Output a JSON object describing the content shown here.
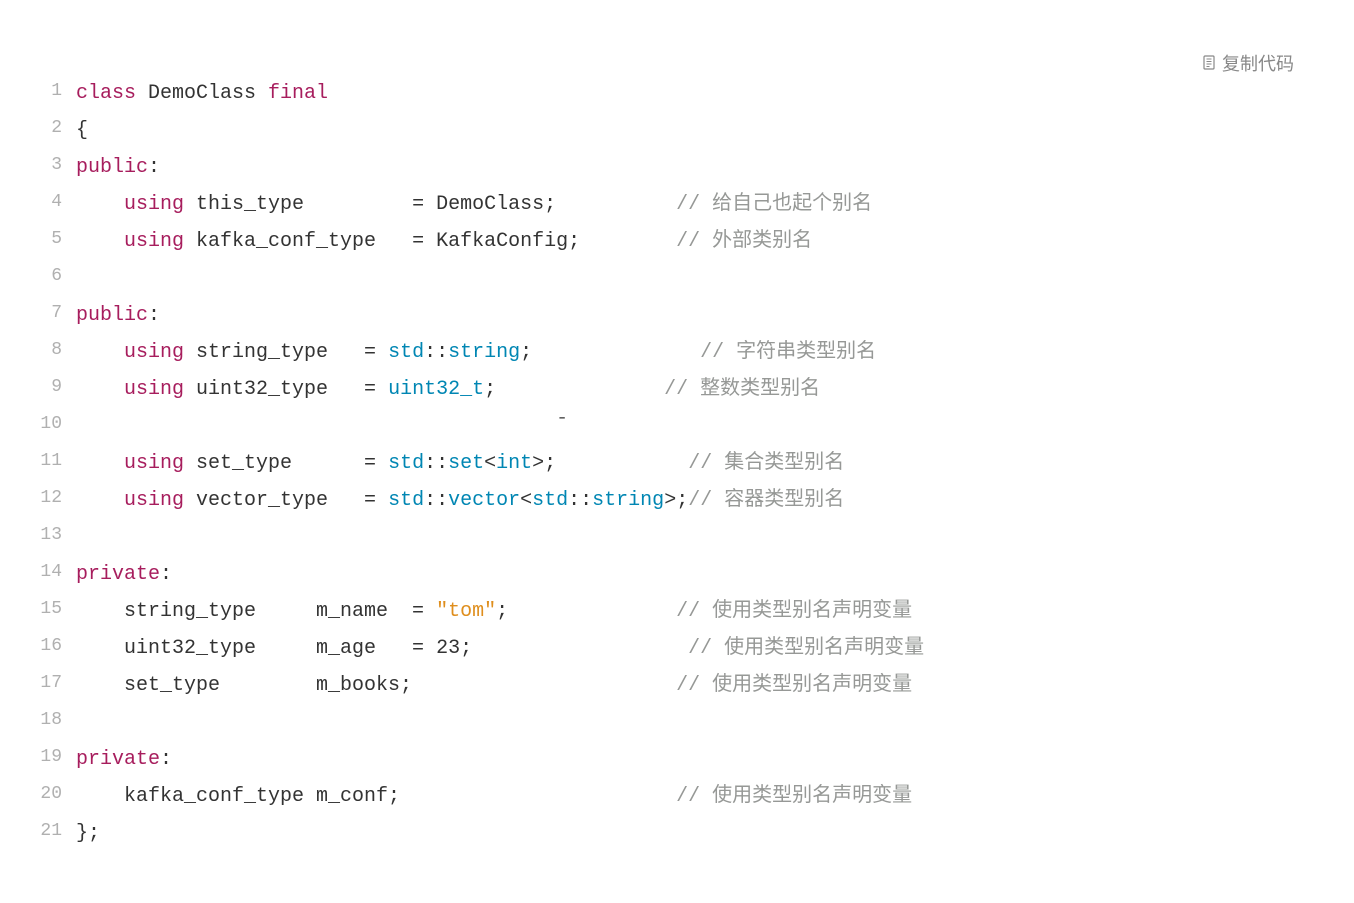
{
  "copyLabel": "复制代码",
  "lines": [
    {
      "num": "1",
      "tokens": [
        {
          "t": "class",
          "c": "kw"
        },
        {
          "t": " DemoClass ",
          "c": "plain"
        },
        {
          "t": "final",
          "c": "kw"
        }
      ]
    },
    {
      "num": "2",
      "tokens": [
        {
          "t": "{",
          "c": "punct"
        }
      ]
    },
    {
      "num": "3",
      "tokens": [
        {
          "t": "public",
          "c": "kw"
        },
        {
          "t": ":",
          "c": "punct"
        }
      ]
    },
    {
      "num": "4",
      "tokens": [
        {
          "t": "    ",
          "c": "plain"
        },
        {
          "t": "using",
          "c": "kw"
        },
        {
          "t": " this_type         = DemoClass;          ",
          "c": "plain"
        },
        {
          "t": "// 给自己也起个别名",
          "c": "comment"
        }
      ]
    },
    {
      "num": "5",
      "tokens": [
        {
          "t": "    ",
          "c": "plain"
        },
        {
          "t": "using",
          "c": "kw"
        },
        {
          "t": " kafka_conf_type   = KafkaConfig;        ",
          "c": "plain"
        },
        {
          "t": "// 外部类别名",
          "c": "comment"
        }
      ]
    },
    {
      "num": "6",
      "tokens": []
    },
    {
      "num": "7",
      "tokens": [
        {
          "t": "public",
          "c": "kw"
        },
        {
          "t": ":",
          "c": "punct"
        }
      ]
    },
    {
      "num": "8",
      "tokens": [
        {
          "t": "    ",
          "c": "plain"
        },
        {
          "t": "using",
          "c": "kw"
        },
        {
          "t": " string_type   = ",
          "c": "plain"
        },
        {
          "t": "std",
          "c": "type"
        },
        {
          "t": "::",
          "c": "plain"
        },
        {
          "t": "string",
          "c": "type"
        },
        {
          "t": ";              ",
          "c": "plain"
        },
        {
          "t": "// 字符串类型别名",
          "c": "comment"
        }
      ]
    },
    {
      "num": "9",
      "tokens": [
        {
          "t": "    ",
          "c": "plain"
        },
        {
          "t": "using",
          "c": "kw"
        },
        {
          "t": " uint32_type   = ",
          "c": "plain"
        },
        {
          "t": "uint32_t",
          "c": "type"
        },
        {
          "t": ";              ",
          "c": "plain"
        },
        {
          "t": "// 整数类型别名",
          "c": "comment"
        }
      ]
    },
    {
      "num": "10",
      "tokens": [
        {
          "t": "                                        ˉ",
          "c": "plain"
        }
      ]
    },
    {
      "num": "11",
      "tokens": [
        {
          "t": "    ",
          "c": "plain"
        },
        {
          "t": "using",
          "c": "kw"
        },
        {
          "t": " set_type      = ",
          "c": "plain"
        },
        {
          "t": "std",
          "c": "type"
        },
        {
          "t": "::",
          "c": "plain"
        },
        {
          "t": "set",
          "c": "type"
        },
        {
          "t": "<",
          "c": "plain"
        },
        {
          "t": "int",
          "c": "type"
        },
        {
          "t": ">;           ",
          "c": "plain"
        },
        {
          "t": "// 集合类型别名",
          "c": "comment"
        }
      ]
    },
    {
      "num": "12",
      "tokens": [
        {
          "t": "    ",
          "c": "plain"
        },
        {
          "t": "using",
          "c": "kw"
        },
        {
          "t": " vector_type   = ",
          "c": "plain"
        },
        {
          "t": "std",
          "c": "type"
        },
        {
          "t": "::",
          "c": "plain"
        },
        {
          "t": "vector",
          "c": "type"
        },
        {
          "t": "<",
          "c": "plain"
        },
        {
          "t": "std",
          "c": "type"
        },
        {
          "t": "::",
          "c": "plain"
        },
        {
          "t": "string",
          "c": "type"
        },
        {
          "t": ">;",
          "c": "plain"
        },
        {
          "t": "// 容器类型别名",
          "c": "comment"
        }
      ]
    },
    {
      "num": "13",
      "tokens": []
    },
    {
      "num": "14",
      "tokens": [
        {
          "t": "private",
          "c": "kw"
        },
        {
          "t": ":",
          "c": "punct"
        }
      ]
    },
    {
      "num": "15",
      "tokens": [
        {
          "t": "    string_type     m_name  = ",
          "c": "plain"
        },
        {
          "t": "\"tom\"",
          "c": "str"
        },
        {
          "t": ";              ",
          "c": "plain"
        },
        {
          "t": "// 使用类型别名声明变量",
          "c": "comment"
        }
      ]
    },
    {
      "num": "16",
      "tokens": [
        {
          "t": "    uint32_type     m_age   = ",
          "c": "plain"
        },
        {
          "t": "23",
          "c": "num"
        },
        {
          "t": ";                  ",
          "c": "plain"
        },
        {
          "t": "// 使用类型别名声明变量",
          "c": "comment"
        }
      ]
    },
    {
      "num": "17",
      "tokens": [
        {
          "t": "    set_type        m_books;                      ",
          "c": "plain"
        },
        {
          "t": "// 使用类型别名声明变量",
          "c": "comment"
        }
      ]
    },
    {
      "num": "18",
      "tokens": []
    },
    {
      "num": "19",
      "tokens": [
        {
          "t": "private",
          "c": "kw"
        },
        {
          "t": ":",
          "c": "punct"
        }
      ]
    },
    {
      "num": "20",
      "tokens": [
        {
          "t": "    kafka_conf_type m_conf;                       ",
          "c": "plain"
        },
        {
          "t": "// 使用类型别名声明变量",
          "c": "comment"
        }
      ]
    },
    {
      "num": "21",
      "tokens": [
        {
          "t": "};",
          "c": "punct"
        }
      ]
    }
  ]
}
